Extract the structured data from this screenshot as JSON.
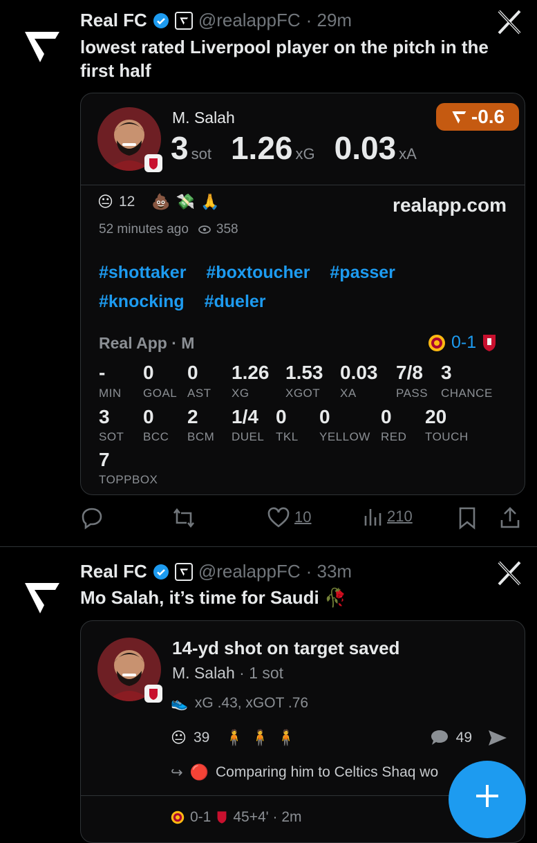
{
  "tweets": [
    {
      "author": "Real FC",
      "handle": "@realappFC",
      "time": "· 29m",
      "text": "lowest rated Liverpool player on the pitch in the first half",
      "card": {
        "player": "M. Salah",
        "sot_value": "3",
        "sot_unit": "sot",
        "xg_value": "1.26",
        "xg_unit": "xG",
        "xa_value": "0.03",
        "xa_unit": "xA",
        "rating": "-0.6",
        "reaction_count": "12",
        "site": "realapp.com",
        "posted": "52 minutes ago",
        "views": "358",
        "hashtags": [
          "#shottaker",
          "#boxtoucher",
          "#passer",
          "#knocking",
          "#dueler"
        ],
        "source": "Real App · M",
        "score": "0-1",
        "stats": [
          {
            "value": "-",
            "label": "MIN"
          },
          {
            "value": "0",
            "label": "GOAL"
          },
          {
            "value": "0",
            "label": "AST"
          },
          {
            "value": "1.26",
            "label": "XG"
          },
          {
            "value": "1.53",
            "label": "XGOT"
          },
          {
            "value": "0.03",
            "label": "XA"
          },
          {
            "value": "7/8",
            "label": "PASS"
          },
          {
            "value": "3",
            "label": "CHANCE"
          },
          {
            "value": "3",
            "label": "SOT"
          },
          {
            "value": "0",
            "label": "BCC"
          },
          {
            "value": "2",
            "label": "BCM"
          },
          {
            "value": "1/4",
            "label": "DUEL"
          },
          {
            "value": "0",
            "label": "TKL"
          },
          {
            "value": "0",
            "label": "YELLOW"
          },
          {
            "value": "0",
            "label": "RED"
          },
          {
            "value": "20",
            "label": "TOUCH"
          },
          {
            "value": "7",
            "label": "TOPPBOX"
          }
        ]
      },
      "likes": "10",
      "views": "210"
    },
    {
      "author": "Real FC",
      "handle": "@realappFC",
      "time": "· 33m",
      "text": "Mo Salah, it’s time for Saudi 🥀",
      "card": {
        "title": "14-yd shot on target saved",
        "player": "M. Salah",
        "player_meta": "· 1 sot",
        "shot_stats": "xG .43, xGOT .76",
        "reaction_count": "39",
        "comment_count": "49",
        "comment_preview": "Comparing him to Celtics Shaq wo",
        "score": "0-1",
        "match_time": "45+4' · 2m"
      }
    }
  ],
  "colors": {
    "accent": "#1d9bf0",
    "rating_badge": "#c55a11",
    "background": "#000000"
  },
  "icons": [
    "realfc-logo-icon",
    "verified-icon",
    "x-logo-icon",
    "reply-icon",
    "retweet-icon",
    "heart-icon",
    "views-icon",
    "bookmark-icon",
    "share-icon",
    "plus-icon"
  ]
}
